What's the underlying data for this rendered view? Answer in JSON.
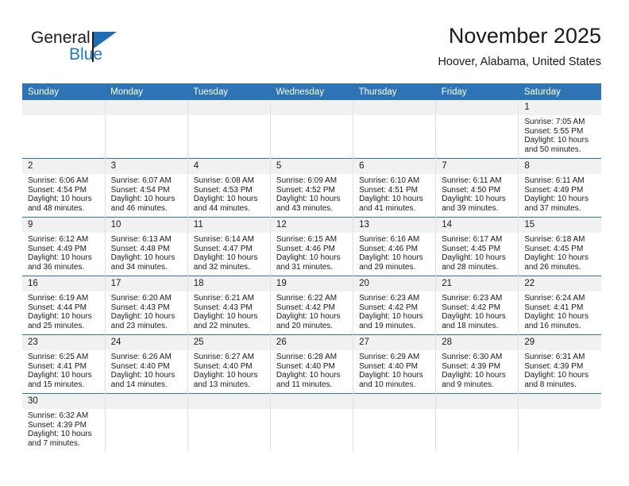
{
  "brand": {
    "name_part1": "General",
    "name_part2": "Blue",
    "logo_icon": "triangle-logo-icon"
  },
  "header": {
    "title": "November 2025",
    "location": "Hoover, Alabama, United States"
  },
  "calendar": {
    "weekday_headers": [
      "Sunday",
      "Monday",
      "Tuesday",
      "Wednesday",
      "Thursday",
      "Friday",
      "Saturday"
    ],
    "accent_color": "#2c74b5",
    "daynum_background": "#f1f1f1",
    "weeks": [
      [
        {
          "day": "",
          "lines": []
        },
        {
          "day": "",
          "lines": []
        },
        {
          "day": "",
          "lines": []
        },
        {
          "day": "",
          "lines": []
        },
        {
          "day": "",
          "lines": []
        },
        {
          "day": "",
          "lines": []
        },
        {
          "day": "1",
          "lines": [
            "Sunrise: 7:05 AM",
            "Sunset: 5:55 PM",
            "Daylight: 10 hours and 50 minutes."
          ]
        }
      ],
      [
        {
          "day": "2",
          "lines": [
            "Sunrise: 6:06 AM",
            "Sunset: 4:54 PM",
            "Daylight: 10 hours and 48 minutes."
          ]
        },
        {
          "day": "3",
          "lines": [
            "Sunrise: 6:07 AM",
            "Sunset: 4:54 PM",
            "Daylight: 10 hours and 46 minutes."
          ]
        },
        {
          "day": "4",
          "lines": [
            "Sunrise: 6:08 AM",
            "Sunset: 4:53 PM",
            "Daylight: 10 hours and 44 minutes."
          ]
        },
        {
          "day": "5",
          "lines": [
            "Sunrise: 6:09 AM",
            "Sunset: 4:52 PM",
            "Daylight: 10 hours and 43 minutes."
          ]
        },
        {
          "day": "6",
          "lines": [
            "Sunrise: 6:10 AM",
            "Sunset: 4:51 PM",
            "Daylight: 10 hours and 41 minutes."
          ]
        },
        {
          "day": "7",
          "lines": [
            "Sunrise: 6:11 AM",
            "Sunset: 4:50 PM",
            "Daylight: 10 hours and 39 minutes."
          ]
        },
        {
          "day": "8",
          "lines": [
            "Sunrise: 6:11 AM",
            "Sunset: 4:49 PM",
            "Daylight: 10 hours and 37 minutes."
          ]
        }
      ],
      [
        {
          "day": "9",
          "lines": [
            "Sunrise: 6:12 AM",
            "Sunset: 4:49 PM",
            "Daylight: 10 hours and 36 minutes."
          ]
        },
        {
          "day": "10",
          "lines": [
            "Sunrise: 6:13 AM",
            "Sunset: 4:48 PM",
            "Daylight: 10 hours and 34 minutes."
          ]
        },
        {
          "day": "11",
          "lines": [
            "Sunrise: 6:14 AM",
            "Sunset: 4:47 PM",
            "Daylight: 10 hours and 32 minutes."
          ]
        },
        {
          "day": "12",
          "lines": [
            "Sunrise: 6:15 AM",
            "Sunset: 4:46 PM",
            "Daylight: 10 hours and 31 minutes."
          ]
        },
        {
          "day": "13",
          "lines": [
            "Sunrise: 6:16 AM",
            "Sunset: 4:46 PM",
            "Daylight: 10 hours and 29 minutes."
          ]
        },
        {
          "day": "14",
          "lines": [
            "Sunrise: 6:17 AM",
            "Sunset: 4:45 PM",
            "Daylight: 10 hours and 28 minutes."
          ]
        },
        {
          "day": "15",
          "lines": [
            "Sunrise: 6:18 AM",
            "Sunset: 4:45 PM",
            "Daylight: 10 hours and 26 minutes."
          ]
        }
      ],
      [
        {
          "day": "16",
          "lines": [
            "Sunrise: 6:19 AM",
            "Sunset: 4:44 PM",
            "Daylight: 10 hours and 25 minutes."
          ]
        },
        {
          "day": "17",
          "lines": [
            "Sunrise: 6:20 AM",
            "Sunset: 4:43 PM",
            "Daylight: 10 hours and 23 minutes."
          ]
        },
        {
          "day": "18",
          "lines": [
            "Sunrise: 6:21 AM",
            "Sunset: 4:43 PM",
            "Daylight: 10 hours and 22 minutes."
          ]
        },
        {
          "day": "19",
          "lines": [
            "Sunrise: 6:22 AM",
            "Sunset: 4:42 PM",
            "Daylight: 10 hours and 20 minutes."
          ]
        },
        {
          "day": "20",
          "lines": [
            "Sunrise: 6:23 AM",
            "Sunset: 4:42 PM",
            "Daylight: 10 hours and 19 minutes."
          ]
        },
        {
          "day": "21",
          "lines": [
            "Sunrise: 6:23 AM",
            "Sunset: 4:42 PM",
            "Daylight: 10 hours and 18 minutes."
          ]
        },
        {
          "day": "22",
          "lines": [
            "Sunrise: 6:24 AM",
            "Sunset: 4:41 PM",
            "Daylight: 10 hours and 16 minutes."
          ]
        }
      ],
      [
        {
          "day": "23",
          "lines": [
            "Sunrise: 6:25 AM",
            "Sunset: 4:41 PM",
            "Daylight: 10 hours and 15 minutes."
          ]
        },
        {
          "day": "24",
          "lines": [
            "Sunrise: 6:26 AM",
            "Sunset: 4:40 PM",
            "Daylight: 10 hours and 14 minutes."
          ]
        },
        {
          "day": "25",
          "lines": [
            "Sunrise: 6:27 AM",
            "Sunset: 4:40 PM",
            "Daylight: 10 hours and 13 minutes."
          ]
        },
        {
          "day": "26",
          "lines": [
            "Sunrise: 6:28 AM",
            "Sunset: 4:40 PM",
            "Daylight: 10 hours and 11 minutes."
          ]
        },
        {
          "day": "27",
          "lines": [
            "Sunrise: 6:29 AM",
            "Sunset: 4:40 PM",
            "Daylight: 10 hours and 10 minutes."
          ]
        },
        {
          "day": "28",
          "lines": [
            "Sunrise: 6:30 AM",
            "Sunset: 4:39 PM",
            "Daylight: 10 hours and 9 minutes."
          ]
        },
        {
          "day": "29",
          "lines": [
            "Sunrise: 6:31 AM",
            "Sunset: 4:39 PM",
            "Daylight: 10 hours and 8 minutes."
          ]
        }
      ],
      [
        {
          "day": "30",
          "lines": [
            "Sunrise: 6:32 AM",
            "Sunset: 4:39 PM",
            "Daylight: 10 hours and 7 minutes."
          ]
        },
        {
          "day": "",
          "lines": []
        },
        {
          "day": "",
          "lines": []
        },
        {
          "day": "",
          "lines": []
        },
        {
          "day": "",
          "lines": []
        },
        {
          "day": "",
          "lines": []
        },
        {
          "day": "",
          "lines": []
        }
      ]
    ]
  }
}
